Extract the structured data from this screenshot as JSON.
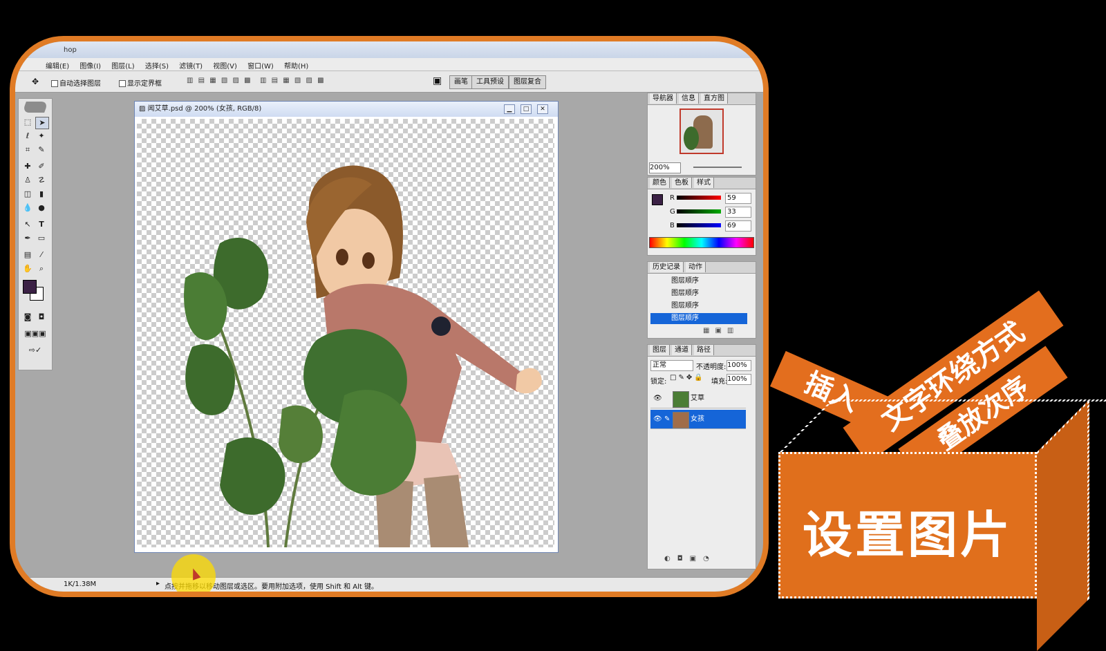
{
  "app": {
    "title_fragment": "hop",
    "menu": [
      "编辑(E)",
      "图像(I)",
      "图层(L)",
      "选择(S)",
      "滤镜(T)",
      "视图(V)",
      "窗口(W)",
      "帮助(H)"
    ],
    "options": {
      "auto_select": "自动选择图层",
      "show_bounds": "显示定界框",
      "well_tabs": [
        "画笔",
        "工具预设",
        "图层复合"
      ]
    }
  },
  "document": {
    "title": "闻艾草.psd @ 200% (女孩, RGB/8)"
  },
  "navigator": {
    "tabs": [
      "导航器",
      "信息",
      "直方图"
    ],
    "zoom": "200%"
  },
  "color": {
    "tabs": [
      "颜色",
      "色板",
      "样式"
    ],
    "channels": [
      {
        "label": "R",
        "value": "59"
      },
      {
        "label": "G",
        "value": "33"
      },
      {
        "label": "B",
        "value": "69"
      }
    ],
    "foreground": "#3b2145"
  },
  "history": {
    "tabs": [
      "历史记录",
      "动作"
    ],
    "items": [
      "图层顺序",
      "图层顺序",
      "图层顺序",
      "图层顺序"
    ]
  },
  "layers": {
    "tabs": [
      "图层",
      "通道",
      "路径"
    ],
    "blend_mode": "正常",
    "opacity_label": "不透明度:",
    "opacity": "100%",
    "lock_label": "锁定:",
    "fill_label": "填充:",
    "fill": "100%",
    "items": [
      {
        "name": "艾草",
        "selected": false
      },
      {
        "name": "女孩",
        "selected": true
      }
    ]
  },
  "status": {
    "doc_size": "1K/1.38M",
    "hint": "点按并拖移以移动图层或选区。要用附加选项，使用 Shift 和 Alt 键。"
  },
  "overlay": {
    "ribbons": [
      "插入",
      "文字环绕方式",
      "叠放次序"
    ],
    "box_title": "设置图片"
  }
}
